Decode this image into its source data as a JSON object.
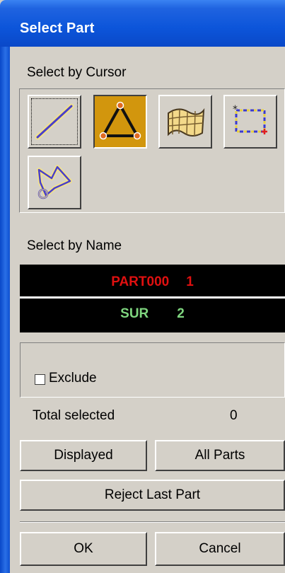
{
  "window": {
    "title": "Select Part"
  },
  "cursor_section": {
    "label": "Select by Cursor",
    "tools": [
      {
        "name": "line-select-icon",
        "active": false
      },
      {
        "name": "triangle-select-icon",
        "active": true
      },
      {
        "name": "surface-select-icon",
        "active": false
      },
      {
        "name": "box-select-icon",
        "active": false
      },
      {
        "name": "polygon-select-icon",
        "active": false
      }
    ]
  },
  "name_section": {
    "label": "Select by Name",
    "items": [
      {
        "name": "PART000",
        "id": "1"
      },
      {
        "name": "SUR",
        "id": "2"
      }
    ]
  },
  "exclude": {
    "label": "Exclude",
    "checked": false
  },
  "total": {
    "label": "Total selected",
    "value": "0"
  },
  "buttons": {
    "displayed": "Displayed",
    "all_parts": "All Parts",
    "reject_last": "Reject Last Part",
    "ok": "OK",
    "cancel": "Cancel"
  },
  "colors": {
    "title_bar": "#0c55da",
    "active_tool": "#d2960d",
    "part_red": "#e01010",
    "part_green": "#7fd67f"
  }
}
